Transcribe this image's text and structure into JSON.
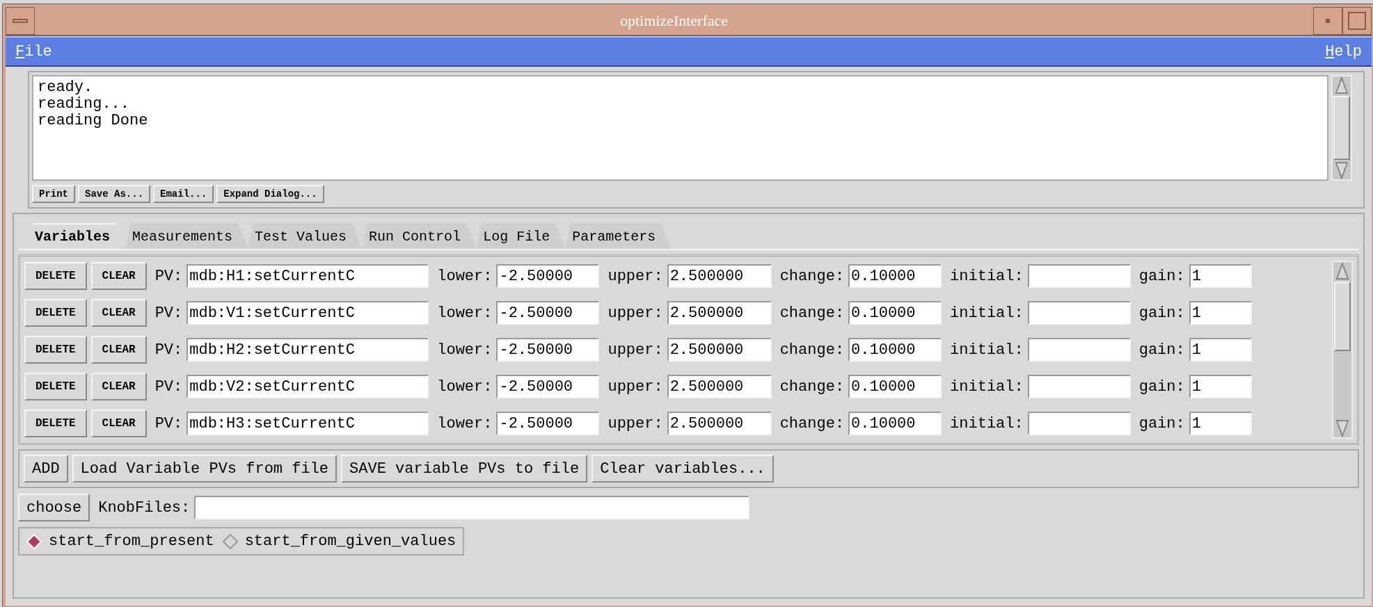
{
  "window": {
    "title": "optimizeInterface"
  },
  "menu": [
    {
      "label": "File"
    },
    {
      "label": "Help"
    }
  ],
  "log": {
    "lines": [
      "ready.",
      "reading...",
      "reading Done"
    ],
    "buttons": [
      "Print",
      "Save As...",
      "Email...",
      "Expand Dialog..."
    ]
  },
  "tabs": [
    {
      "label": "Variables",
      "selected": true
    },
    {
      "label": "Measurements",
      "selected": false
    },
    {
      "label": "Test Values",
      "selected": false
    },
    {
      "label": "Run Control",
      "selected": false
    },
    {
      "label": "Log File",
      "selected": false
    },
    {
      "label": "Parameters",
      "selected": false
    }
  ],
  "variables": [
    {
      "buttons": [
        "DELETE",
        "CLEAR"
      ],
      "fields": [
        {
          "label": "PV:",
          "value": "mdb:H1:setCurrentC"
        },
        {
          "label": "lower:",
          "value": "-2.50000"
        },
        {
          "label": "upper:",
          "value": "2.500000"
        },
        {
          "label": "change:",
          "value": "0.10000"
        },
        {
          "label": "initial:"
        },
        {
          "label": "gain:",
          "value": "1"
        }
      ]
    },
    {
      "buttons": [
        "DELETE",
        "CLEAR"
      ],
      "fields": [
        {
          "label": "PV:",
          "value": "mdb:V1:setCurrentC"
        },
        {
          "label": "lower:",
          "value": "-2.50000"
        },
        {
          "label": "upper:",
          "value": "2.500000"
        },
        {
          "label": "change:",
          "value": "0.10000"
        },
        {
          "label": "initial:"
        },
        {
          "label": "gain:",
          "value": "1"
        }
      ]
    },
    {
      "buttons": [
        "DELETE",
        "CLEAR"
      ],
      "fields": [
        {
          "label": "PV:",
          "value": "mdb:H2:setCurrentC"
        },
        {
          "label": "lower:",
          "value": "-2.50000"
        },
        {
          "label": "upper:",
          "value": "2.500000"
        },
        {
          "label": "change:",
          "value": "0.10000"
        },
        {
          "label": "initial:"
        },
        {
          "label": "gain:",
          "value": "1"
        }
      ]
    },
    {
      "buttons": [
        "DELETE",
        "CLEAR"
      ],
      "fields": [
        {
          "label": "PV:",
          "value": "mdb:V2:setCurrentC"
        },
        {
          "label": "lower:",
          "value": "-2.50000"
        },
        {
          "label": "upper:",
          "value": "2.500000"
        },
        {
          "label": "change:",
          "value": "0.10000"
        },
        {
          "label": "initial:"
        },
        {
          "label": "gain:",
          "value": "1"
        }
      ]
    },
    {
      "buttons": [
        "DELETE",
        "CLEAR"
      ],
      "fields": [
        {
          "label": "PV:",
          "value": "mdb:H3:setCurrentC"
        },
        {
          "label": "lower:",
          "value": "-2.50000"
        },
        {
          "label": "upper:",
          "value": "2.500000"
        },
        {
          "label": "change:",
          "value": "0.10000"
        },
        {
          "label": "initial:"
        },
        {
          "label": "gain:",
          "value": "1"
        }
      ]
    }
  ],
  "variable_actions": [
    "ADD",
    "Load Variable PVs from file",
    "SAVE variable PVs to file",
    "Clear variables..."
  ],
  "knob": {
    "button": "choose",
    "label": "KnobFiles:"
  },
  "start_mode": [
    {
      "label": "start_from_present",
      "selected": true
    },
    {
      "label": "start_from_given_values",
      "selected": false
    }
  ]
}
